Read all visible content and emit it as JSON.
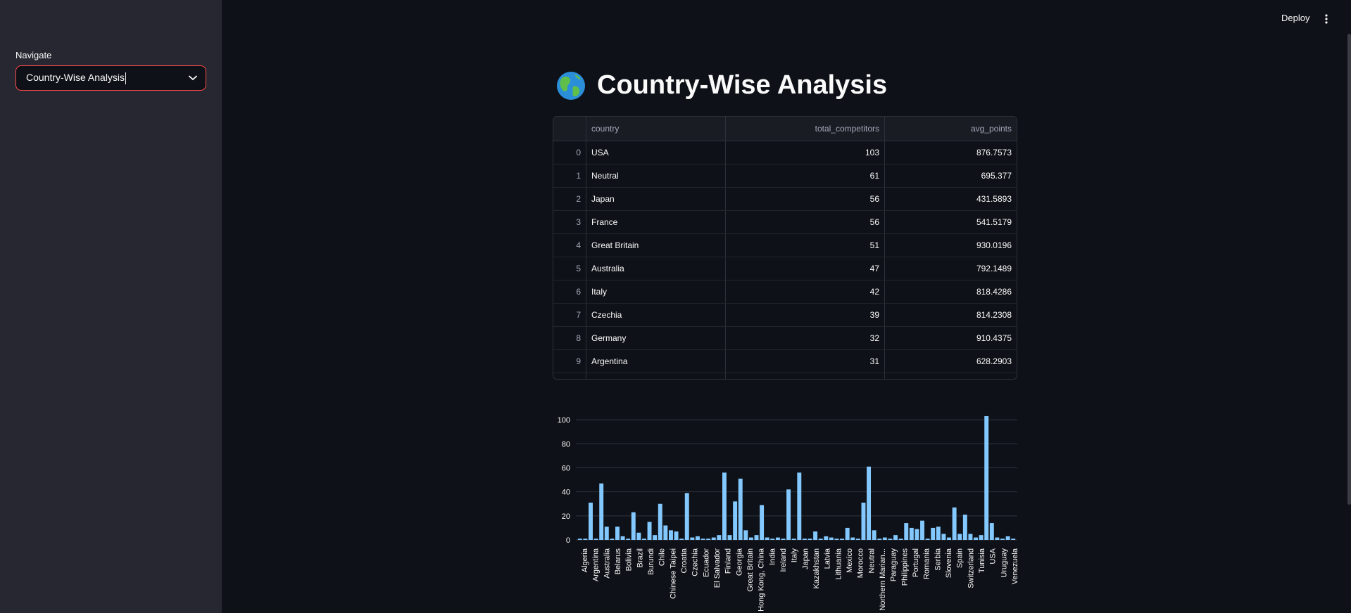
{
  "sidebar": {
    "nav_label": "Navigate",
    "select_value": "Country-Wise Analysis"
  },
  "header": {
    "deploy_label": "Deploy",
    "menu_icon": "vertical-dots-icon"
  },
  "page": {
    "title": "Country-Wise Analysis",
    "title_icon": "globe-icon"
  },
  "table": {
    "columns": [
      "",
      "country",
      "total_competitors",
      "avg_points"
    ],
    "rows": [
      {
        "idx": "0",
        "country": "USA",
        "total_competitors": "103",
        "avg_points": "876.7573"
      },
      {
        "idx": "1",
        "country": "Neutral",
        "total_competitors": "61",
        "avg_points": "695.377"
      },
      {
        "idx": "2",
        "country": "Japan",
        "total_competitors": "56",
        "avg_points": "431.5893"
      },
      {
        "idx": "3",
        "country": "France",
        "total_competitors": "56",
        "avg_points": "541.5179"
      },
      {
        "idx": "4",
        "country": "Great Britain",
        "total_competitors": "51",
        "avg_points": "930.0196"
      },
      {
        "idx": "5",
        "country": "Australia",
        "total_competitors": "47",
        "avg_points": "792.1489"
      },
      {
        "idx": "6",
        "country": "Italy",
        "total_competitors": "42",
        "avg_points": "818.4286"
      },
      {
        "idx": "7",
        "country": "Czechia",
        "total_competitors": "39",
        "avg_points": "814.2308"
      },
      {
        "idx": "8",
        "country": "Germany",
        "total_competitors": "32",
        "avg_points": "910.4375"
      },
      {
        "idx": "9",
        "country": "Argentina",
        "total_competitors": "31",
        "avg_points": "628.2903"
      }
    ]
  },
  "chart_data": {
    "type": "bar",
    "color": "#83c9ff",
    "ylim": [
      0,
      110
    ],
    "yticks": [
      0,
      20,
      40,
      60,
      80,
      100
    ],
    "grid": true,
    "xtick_labels": [
      "Algeria",
      "Argentina",
      "Australia",
      "Belarus",
      "Bolivia",
      "Brazil",
      "Burundi",
      "Chile",
      "Chinese Taipei",
      "Croatia",
      "Czechia",
      "Ecuador",
      "El Salvador",
      "Finland",
      "Georgia",
      "Great Britain",
      "Hong Kong, China",
      "India",
      "Ireland",
      "Italy",
      "Japan",
      "Kazakhstan",
      "Latvia",
      "Lithuania",
      "Mexico",
      "Morocco",
      "Neutral",
      "Northern Marian...",
      "Paraguay",
      "Philippines",
      "Portugal",
      "Romania",
      "Serbia",
      "Slovenia",
      "Spain",
      "Switzerland",
      "Tunisia",
      "USA",
      "Uruguay",
      "Venezuela"
    ],
    "values": [
      1,
      1,
      31,
      1,
      47,
      11,
      1,
      11,
      3,
      1,
      23,
      6,
      1,
      15,
      4,
      30,
      12,
      8,
      7,
      1,
      39,
      2,
      3,
      1,
      1,
      2,
      4,
      56,
      4,
      32,
      51,
      8,
      2,
      4,
      29,
      2,
      1,
      2,
      1,
      42,
      1,
      56,
      1,
      1,
      7,
      1,
      3,
      2,
      1,
      1,
      10,
      2,
      1,
      31,
      61,
      8,
      1,
      2,
      1,
      4,
      1,
      14,
      10,
      9,
      16,
      1,
      10,
      11,
      5,
      2,
      27,
      5,
      21,
      5,
      2,
      4,
      103,
      14,
      2,
      1,
      3,
      1
    ]
  }
}
